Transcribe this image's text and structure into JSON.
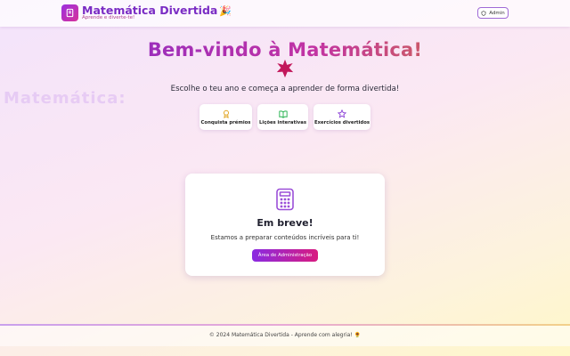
{
  "header": {
    "title": "Matemática Divertida",
    "title_emoji": "🎉",
    "subtitle": "Aprende e diverte-te!",
    "admin_label": "Admin"
  },
  "hero": {
    "title": "Bem-vindo à Matemática!",
    "subtitle": "Escolhe o teu ano e começa a aprender de forma divertida!"
  },
  "features": [
    {
      "label": "Conquista prémios",
      "icon": "award-icon",
      "color": "#e0a21b"
    },
    {
      "label": "Lições interativas",
      "icon": "book-open-icon",
      "color": "#22b14c"
    },
    {
      "label": "Exercícios divertidos",
      "icon": "star-icon",
      "color": "#8a3fd6"
    }
  ],
  "card": {
    "title": "Em breve!",
    "text": "Estamos a preparar conteúdos incríveis para ti!",
    "button_label": "Área de Administração"
  },
  "footer": {
    "text": "© 2024 Matemática Divertida - Aprende com alegria! 🌻"
  },
  "colors": {
    "brand_purple": "#7a2cc4",
    "brand_pink": "#d7339a",
    "accent_orange": "#d68a1c"
  }
}
